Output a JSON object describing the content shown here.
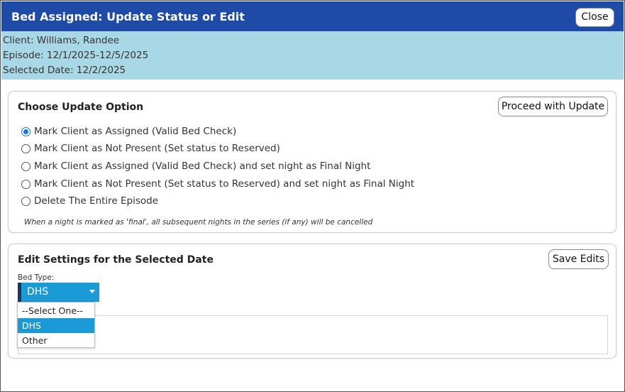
{
  "dialog": {
    "title": "Bed Assigned: Update Status or Edit",
    "close_label": "Close"
  },
  "info": {
    "client": "Client: Williams, Randee",
    "episode": "Episode: 12/1/2025-12/5/2025",
    "selected_date": "Selected Date: 12/2/2025"
  },
  "update_panel": {
    "heading": "Choose Update Option",
    "proceed_label": "Proceed with Update",
    "options": [
      {
        "label": "Mark Client as Assigned (Valid Bed Check)",
        "checked": true
      },
      {
        "label": "Mark Client as Not Present (Set status to Reserved)",
        "checked": false
      },
      {
        "label": "Mark Client as Assigned (Valid Bed Check) and set night as Final Night",
        "checked": false
      },
      {
        "label": "Mark Client as Not Present (Set status to Reserved) and set night as Final Night",
        "checked": false
      },
      {
        "label": "Delete The Entire Episode",
        "checked": false
      }
    ],
    "note": "When a night is marked as 'final', all subsequent nights in the series (if any) will be cancelled"
  },
  "edit_panel": {
    "heading": "Edit Settings for the Selected Date",
    "save_label": "Save Edits",
    "bed_type_label": "Bed Type:",
    "bed_type_value": "DHS",
    "bed_type_options": [
      "--Select One--",
      "DHS",
      "Other"
    ],
    "bed_type_selected_index": 1
  },
  "colors": {
    "title_bar": "#1e4aa8",
    "info_bar": "#a8d8e6",
    "select_accent": "#1a9ad6",
    "radio_checked": "#1a73e8"
  }
}
